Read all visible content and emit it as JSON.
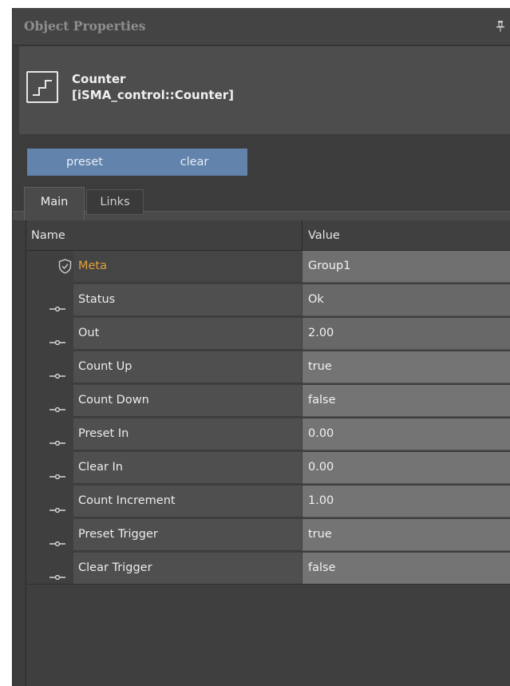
{
  "panel": {
    "title": "Object Properties",
    "pin_icon": "pin-icon"
  },
  "object": {
    "name": "Counter",
    "type": "[iSMA_control::Counter]",
    "icon": "counter-step-icon"
  },
  "actions": {
    "preset_label": "preset",
    "clear_label": "clear"
  },
  "tabs": [
    {
      "label": "Main",
      "active": true
    },
    {
      "label": "Links",
      "active": false
    }
  ],
  "grid": {
    "columns": {
      "name": "Name",
      "value": "Value"
    },
    "rows": [
      {
        "icon": "shield-check-icon",
        "name": "Meta",
        "value": "Group1"
      },
      {
        "icon": "slot-connector-icon",
        "name": "Status",
        "value": "Ok"
      },
      {
        "icon": "slot-connector-icon",
        "name": "Out",
        "value": "2.00"
      },
      {
        "icon": "slot-connector-icon",
        "name": "Count Up",
        "value": "true"
      },
      {
        "icon": "slot-connector-icon",
        "name": "Count Down",
        "value": "false"
      },
      {
        "icon": "slot-connector-icon",
        "name": "Preset In",
        "value": "0.00"
      },
      {
        "icon": "slot-connector-icon",
        "name": "Clear In",
        "value": "0.00"
      },
      {
        "icon": "slot-connector-icon",
        "name": "Count Increment",
        "value": "1.00"
      },
      {
        "icon": "slot-connector-icon",
        "name": "Preset Trigger",
        "value": "true"
      },
      {
        "icon": "slot-connector-icon",
        "name": "Clear Trigger",
        "value": "false"
      }
    ]
  },
  "colors": {
    "accent_button": "#6283ab",
    "meta_label": "#e2a13a",
    "panel_bg": "#3c3c3c"
  }
}
